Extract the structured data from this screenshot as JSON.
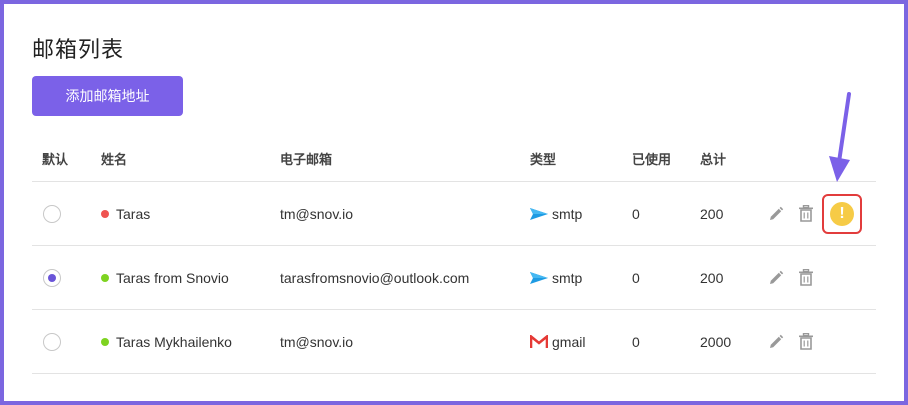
{
  "page": {
    "title": "邮箱列表",
    "add_button_label": "添加邮箱地址"
  },
  "table": {
    "headers": {
      "default": "默认",
      "name": "姓名",
      "email": "电子邮箱",
      "type": "类型",
      "used": "已使用",
      "total": "总计"
    },
    "rows": [
      {
        "default_selected": false,
        "status_color": "#ef5350",
        "name": "Taras",
        "email": "tm@snov.io",
        "type": "smtp",
        "type_icon": "smtp-paper-plane-icon",
        "used": "0",
        "total": "200",
        "has_warning": true,
        "warning_symbol": "!"
      },
      {
        "default_selected": true,
        "status_color": "#7ed321",
        "name": "Taras from Snovio",
        "email": "tarasfromsnovio@outlook.com",
        "type": "smtp",
        "type_icon": "smtp-paper-plane-icon",
        "used": "0",
        "total": "200",
        "has_warning": false
      },
      {
        "default_selected": false,
        "status_color": "#7ed321",
        "name": "Taras Mykhailenko",
        "email": "tm@snov.io",
        "type": "gmail",
        "type_icon": "gmail-icon",
        "used": "0",
        "total": "2000",
        "has_warning": false
      }
    ]
  },
  "colors": {
    "accent": "#7b61e8",
    "frame_border": "#7b66e0",
    "annotation_arrow": "#7b61e8",
    "highlight_box": "#e23c3c",
    "warning": "#f6cb46"
  },
  "icons": {
    "edit": "pencil-icon",
    "delete": "trash-icon",
    "warning": "warning-icon",
    "annotation": "arrow-down-icon"
  }
}
